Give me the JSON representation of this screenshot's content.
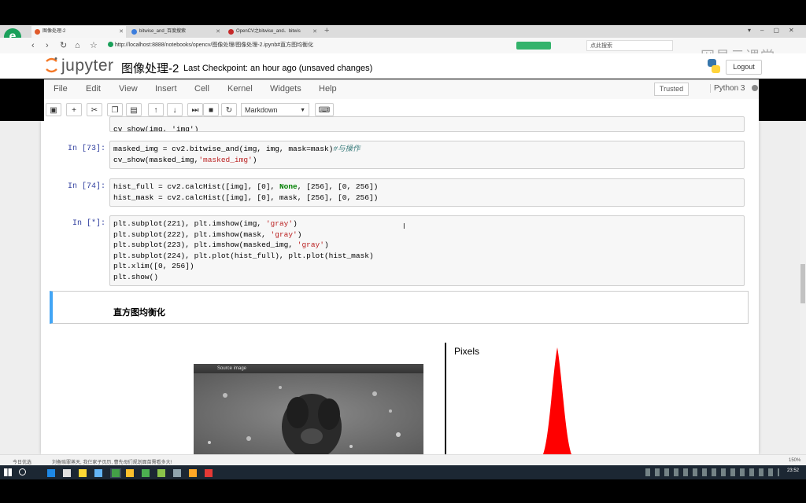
{
  "browser": {
    "tabs": [
      {
        "label": "图像处理-2",
        "color": "#e05a2b"
      },
      {
        "label": "bitwise_and_百度搜索",
        "color": "#3b7ddd"
      },
      {
        "label": "OpenCV之bitwise_and、bitwis",
        "color": "#c62828"
      }
    ],
    "url": "http://localhost:8888/notebooks/opencv/图像处理/图像处理-2.ipynb#直方图均衡化",
    "search_placeholder": "点此搜索",
    "status_left": "今日优选",
    "status_news": "刘备赔罪蒸天, 我仨家子页历, 曹先母们规划面苗需看多大!",
    "zoom": "150%",
    "clock": "23:52"
  },
  "watermark": "网易云课堂",
  "jupyter": {
    "logo_text": "jupyter",
    "notebook_title": "图像处理-2",
    "checkpoint": "Last Checkpoint: an hour ago (unsaved changes)",
    "logout": "Logout",
    "menu": [
      "File",
      "Edit",
      "View",
      "Insert",
      "Cell",
      "Kernel",
      "Widgets",
      "Help"
    ],
    "trusted": "Trusted",
    "kernel": "Python 3",
    "cell_type": "Markdown"
  },
  "cells": {
    "c0_tail": "cv_show(img, 'img')",
    "c73_prompt": "In [73]:",
    "c74_prompt": "In [74]:",
    "cstar_prompt": "In [*]:",
    "markdown_heading": "直方图均衡化",
    "output_window_title": "Source image",
    "output_ylabel": "Pixels"
  }
}
